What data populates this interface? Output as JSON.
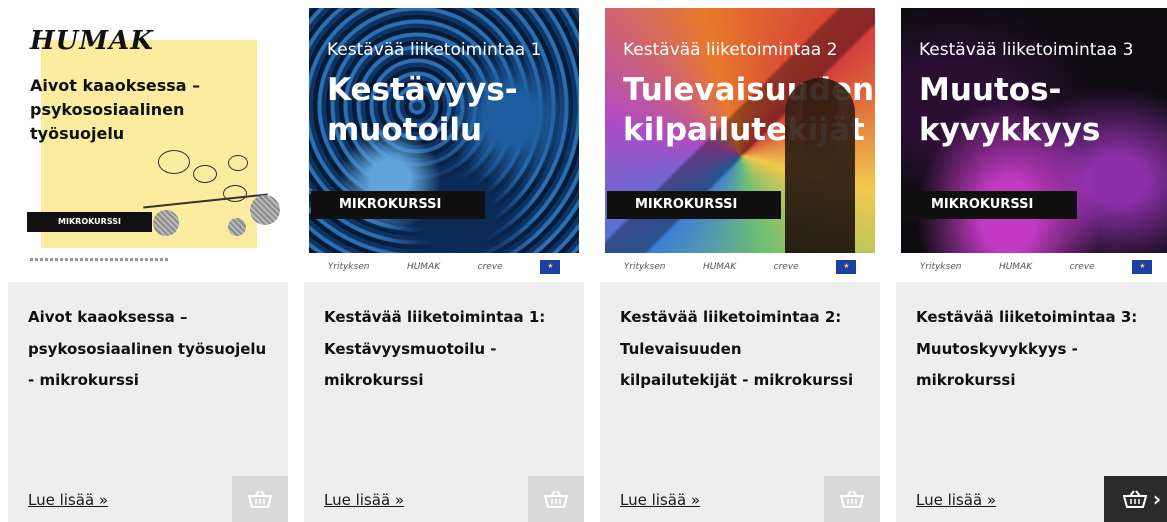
{
  "cards": [
    {
      "poster_logo": "HUMAK",
      "poster_title": "Aivot kaaoksessa – psykososiaalinen työsuojelu",
      "badge": "MIKROKURSSI",
      "title": "Aivot kaaoksessa – psykososiaalinen työsuojelu - mikrokurssi",
      "link": "Lue lisää »",
      "cart_icon": "basket-icon",
      "cart_active": false
    },
    {
      "image_subtitle": "Kestävää liiketoimintaa 1",
      "image_title": "Kestävyys-muotoilu",
      "badge": "MIKROKURSSI",
      "logos": [
        "Yrityksen",
        "HUMAK",
        "creve",
        "EU"
      ],
      "title": "Kestävää liiketoimintaa 1: Kestävyysmuotoilu - mikrokurssi",
      "link": "Lue lisää »",
      "cart_icon": "basket-icon",
      "cart_active": false
    },
    {
      "image_subtitle": "Kestävää liiketoimintaa 2",
      "image_title": "Tulevaisuuden kilpailutekijät",
      "badge": "MIKROKURSSI",
      "logos": [
        "Yrityksen",
        "HUMAK",
        "creve",
        "EU"
      ],
      "title": "Kestävää liiketoimintaa 2: Tulevaisuuden kilpailutekijät - mikrokurssi",
      "link": "Lue lisää »",
      "cart_icon": "basket-icon",
      "cart_active": false
    },
    {
      "image_subtitle": "Kestävää liiketoimintaa 3",
      "image_title": "Muutos-kyvykkyys",
      "badge": "MIKROKURSSI",
      "logos": [
        "Yrityksen",
        "HUMAK",
        "creve",
        "EU"
      ],
      "title": "Kestävää liiketoimintaa 3: Muutoskyvykkyys - mikrokurssi",
      "link": "Lue lisää »",
      "cart_icon": "basket-icon",
      "cart_active": true,
      "cart_arrow": "›"
    }
  ],
  "colors": {
    "panel_bg": "#eeeeee",
    "cart_bg": "#d9d9d9",
    "cart_active_bg": "#2b2b2b",
    "badge_bg": "#101010"
  }
}
